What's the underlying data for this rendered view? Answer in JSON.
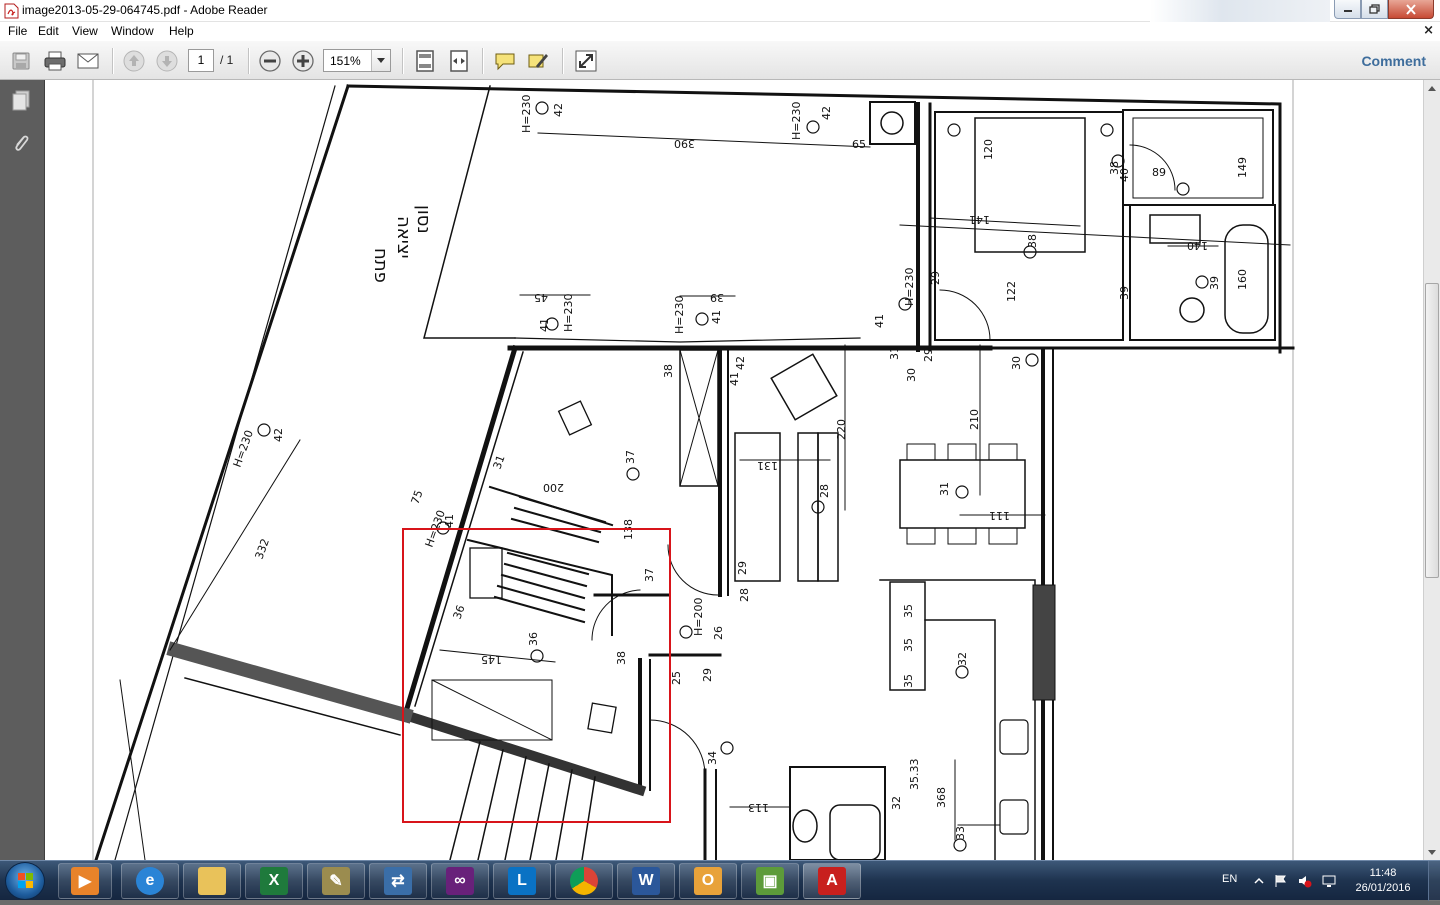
{
  "window": {
    "title": "image2013-05-29-064745.pdf - Adobe Reader"
  },
  "menu": {
    "items": [
      "File",
      "Edit",
      "View",
      "Window",
      "Help"
    ],
    "close_label": "×"
  },
  "toolbar": {
    "page_current": "1",
    "page_total": "/ 1",
    "zoom": "151%",
    "comment_label": "Comment"
  },
  "drawing": {
    "labels": {
      "exit_line1": "פתח",
      "exit_line2": "יציאה",
      "exit_line3": "נסון"
    },
    "dims": [
      "H=230",
      "42",
      "390",
      "H=230",
      "42",
      "65",
      "45",
      "41",
      "H=230",
      "39",
      "H=230",
      "41",
      "H=230",
      "42",
      "332",
      "75",
      "H=230",
      "41",
      "200",
      "37",
      "138",
      "31",
      "36",
      "145",
      "36",
      "38",
      "37",
      "131",
      "220",
      "28",
      "29",
      "28",
      "H=200",
      "26",
      "29",
      "25",
      "34",
      "38",
      "41",
      "42",
      "30",
      "31",
      "29",
      "41",
      "H=230",
      "29",
      "210",
      "122",
      "31",
      "111",
      "35",
      "35",
      "35",
      "32",
      "368",
      "33",
      "32",
      "35.33",
      "113",
      "120",
      "38",
      "141",
      "140",
      "39",
      "149",
      "160",
      "39",
      "89",
      "40",
      "38",
      "30"
    ]
  },
  "taskbar": {
    "language": "EN",
    "time": "11:48",
    "date": "26/01/2016",
    "apps": [
      "media-player",
      "internet-explorer",
      "file-explorer",
      "excel",
      "tools",
      "network",
      "visual-studio",
      "lync",
      "chrome",
      "word",
      "outlook",
      "installer",
      "adobe-reader"
    ]
  },
  "colors": {
    "highlight_rect": "#d8141a",
    "toolbar_bg": "#ececec",
    "comment_link": "#3e6d9c"
  }
}
